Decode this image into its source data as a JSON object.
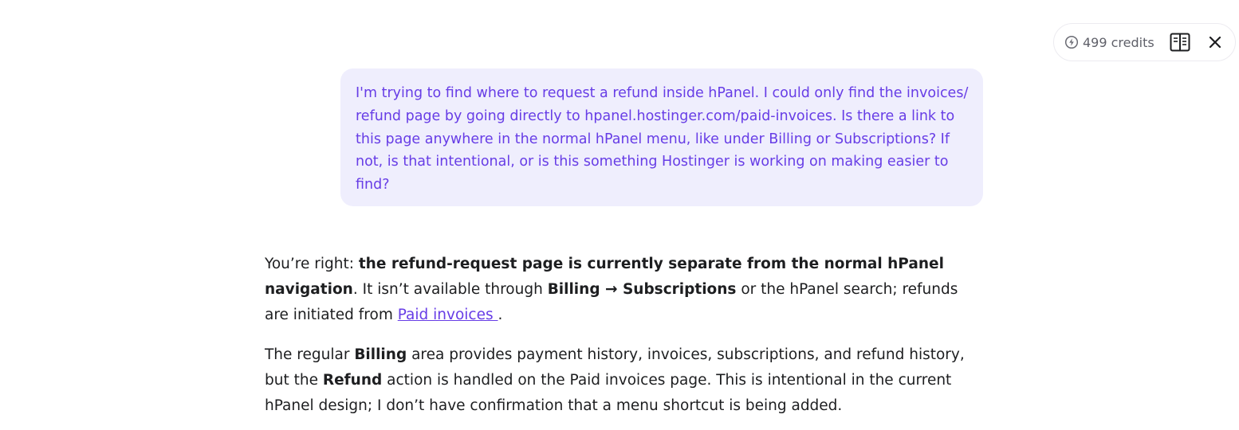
{
  "header": {
    "credits_label": "499 credits",
    "icons": [
      "credits-icon",
      "side-panel-icon",
      "close-icon"
    ]
  },
  "chat": {
    "user_message": "I'm trying to find where to request a refund inside hPanel. I could only find the invoices/ refund page by going directly to hpanel.hostinger.com/paid-invoices. Is there a link to this page anywhere in the normal hPanel menu, like under Billing or Subscriptions? If not, is that intentional, or is this something Hostinger is working on making easier to find?",
    "answer": {
      "p1": {
        "t1": "You’re right: ",
        "b1": "the refund-request page is currently separate from the normal hPanel navigation",
        "t2": ". It isn’t available through ",
        "b2": "Billing → Subscriptions",
        "t3": " or the hPanel search; refunds are initiated from ",
        "link": "Paid invoices ",
        "t4": "."
      },
      "p2": {
        "t1": "The regular ",
        "b1": "Billing",
        "t2": " area provides payment history, invoices, subscriptions, and refund history, but the ",
        "b2": "Refund",
        "t3": " action is handled on the Paid invoices page. This is intentional in the current hPanel design; I don’t have confirmation that a menu shortcut is being added."
      }
    }
  },
  "colors": {
    "accent": "#673de6",
    "bubble_bg": "#efeefd",
    "text": "#1d1e20",
    "muted": "#5f6069"
  }
}
